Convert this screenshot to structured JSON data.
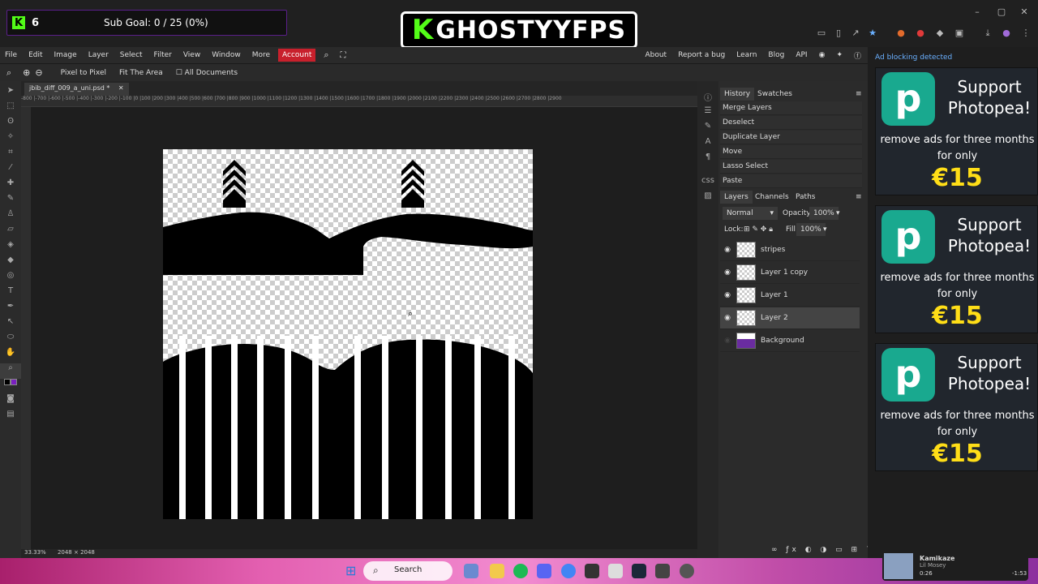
{
  "overlay": {
    "kick_count": "6",
    "sub_goal": "Sub Goal: 0 / 25 (0%)",
    "brand": "GHOSTYYFPS"
  },
  "menu": {
    "items": [
      "File",
      "Edit",
      "Image",
      "Layer",
      "Select",
      "Filter",
      "View",
      "Window",
      "More"
    ],
    "account": "Account",
    "right": [
      "About",
      "Report a bug",
      "Learn",
      "Blog",
      "API"
    ]
  },
  "options": {
    "pixel_to_pixel": "Pixel to Pixel",
    "fit_area": "Fit The Area",
    "all_documents": "All Documents"
  },
  "document": {
    "tab": "jbib_diff_009_a_uni.psd *",
    "zoom": "33.33%",
    "size": "2048 × 2048"
  },
  "ruler": "-800 |-700 |-600 |-500 |-400 |-300 |-200 |-100 |0 |100 |200 |300 |400 |500 |600 |700 |800 |900 |1000 |1100 |1200 |1300 |1400 |1500 |1600 |1700 |1800 |1900 |2000 |2100 |2200 |2300 |2400 |2500 |2600 |2700 |2800 |2900",
  "history": {
    "tabs": [
      "History",
      "Swatches"
    ],
    "items": [
      "Merge Layers",
      "Deselect",
      "Duplicate Layer",
      "Move",
      "Lasso Select",
      "Paste"
    ]
  },
  "layers_panel": {
    "tabs": [
      "Layers",
      "Channels",
      "Paths"
    ],
    "blend": "Normal",
    "opacity_label": "Opacity:",
    "opacity": "100%",
    "lock_label": "Lock:",
    "fill_label": "Fill:",
    "fill": "100%",
    "layers": [
      {
        "name": "stripes",
        "visible": true
      },
      {
        "name": "Layer 1 copy",
        "visible": true
      },
      {
        "name": "Layer 1",
        "visible": true
      },
      {
        "name": "Layer 2",
        "visible": true,
        "selected": true
      },
      {
        "name": "Background",
        "visible": false
      }
    ]
  },
  "ads": {
    "header": "Ad blocking detected",
    "title": "Support Photopea!",
    "body": "remove ads for three months for only",
    "price": "€15"
  },
  "taskbar": {
    "search": "Search",
    "media_title": "Kamikaze",
    "media_artist": "Lil Mosey",
    "media_time": "0:26",
    "media_remaining": "-1:53"
  }
}
